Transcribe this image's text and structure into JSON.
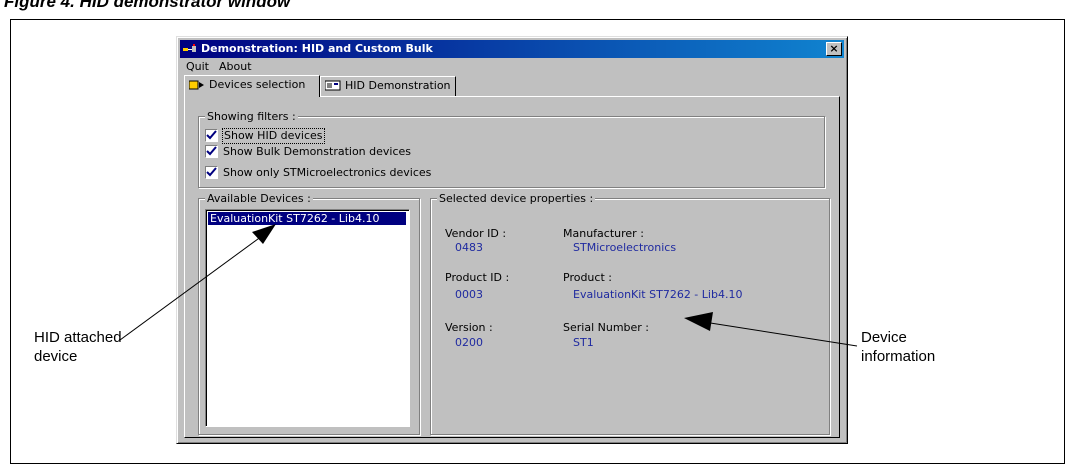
{
  "figure": {
    "title": "Figure 4.     HID demonstrator window"
  },
  "callouts": {
    "left": [
      "HID attached",
      "device"
    ],
    "right": [
      "Device",
      "information"
    ]
  },
  "window": {
    "title": "Demonstration: HID and Custom Bulk",
    "close_glyph": "×",
    "menu": [
      "Quit",
      "About"
    ],
    "tabs": [
      {
        "label": "Devices selection",
        "icon": "device-select-icon",
        "active": true
      },
      {
        "label": "HID Demonstration",
        "icon": "hid-demo-icon",
        "active": false
      }
    ]
  },
  "filters": {
    "legend": "Showing filters :",
    "items": [
      {
        "label": "Show HID devices",
        "checked": true
      },
      {
        "label": "Show Bulk Demonstration devices",
        "checked": true
      },
      {
        "label": "Show only STMicroelectronics devices",
        "checked": true
      }
    ]
  },
  "available_devices": {
    "legend": "Available Devices :",
    "items": [
      "EvaluationKit ST7262 - Lib4.10"
    ]
  },
  "properties": {
    "legend": "Selected device properties :",
    "vendor_id": {
      "label": "Vendor ID :",
      "value": "0483"
    },
    "manufacturer": {
      "label": "Manufacturer :",
      "value": "STMicroelectronics"
    },
    "product_id": {
      "label": "Product ID :",
      "value": "0003"
    },
    "product": {
      "label": "Product :",
      "value": "EvaluationKit ST7262 - Lib4.10"
    },
    "version": {
      "label": "Version :",
      "value": "0200"
    },
    "serial": {
      "label": "Serial Number :",
      "value": "ST1"
    }
  },
  "colors": {
    "value_text": "#1f2aa0",
    "selection": "#000080",
    "titlebar_start": "#000080",
    "titlebar_end": "#1084d0",
    "face": "#c0c0c0"
  }
}
